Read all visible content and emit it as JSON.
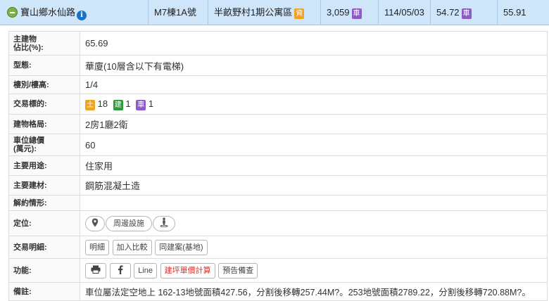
{
  "summary": {
    "address": "寶山鄉水仙路",
    "unit": "M7棟1A號",
    "community": "半畝野村1期公寓區",
    "community_tag": "資",
    "total_price": "3,059",
    "total_price_tag": "車",
    "date": "114/05/03",
    "area": "54.72",
    "area_tag": "車",
    "unit_price": "55.91",
    "colors": {
      "row_bg": "#cfe5fa",
      "tag_orange": "#f0a31f",
      "tag_purple": "#8e5ac8",
      "tag_green": "#2a9a3a"
    }
  },
  "detail": {
    "main_ratio": {
      "label_1": "主建物",
      "label_2": "佔比(%):",
      "value": "65.69"
    },
    "type": {
      "label": "型態:",
      "value": "華廈(10層含以下有電梯)"
    },
    "floor": {
      "label": "樓別/樓高:",
      "value": "1/4"
    },
    "target": {
      "label": "交易標的:",
      "land_tag": "土",
      "land_count": "18",
      "building_tag": "建",
      "building_count": "1",
      "parking_tag": "車",
      "parking_count": "1"
    },
    "layout": {
      "label": "建物格局:",
      "value": "2房1廳2衛"
    },
    "parking_price": {
      "label_1": "車位總價",
      "label_2": "(萬元):",
      "value": "60"
    },
    "usage": {
      "label": "主要用途:",
      "value": "住家用"
    },
    "material": {
      "label": "主要建材:",
      "value": "鋼筋混凝土造"
    },
    "cancel": {
      "label": "解約情形:",
      "value": ""
    },
    "location": {
      "label": "定位:",
      "nearby_button": "周邊設施",
      "map_icon": "map-pin-icon",
      "street_icon": "street-view-icon"
    },
    "transaction": {
      "label": "交易明細:",
      "detail_button": "明細",
      "compare_button": "加入比較",
      "same_case_button": "同建案(基地)"
    },
    "functions": {
      "label": "功能:",
      "print_icon": "print-icon",
      "facebook_icon": "facebook-icon",
      "line_button": "Line",
      "calc_button": "建坪單價計算",
      "presale_button": "預告備查"
    },
    "remark": {
      "label": "備註:",
      "value": "車位屬法定空地上 162-13地號面積427.56，分割後移轉257.44M?。253地號面積2789.22，分割後移轉720.88M?。"
    }
  }
}
